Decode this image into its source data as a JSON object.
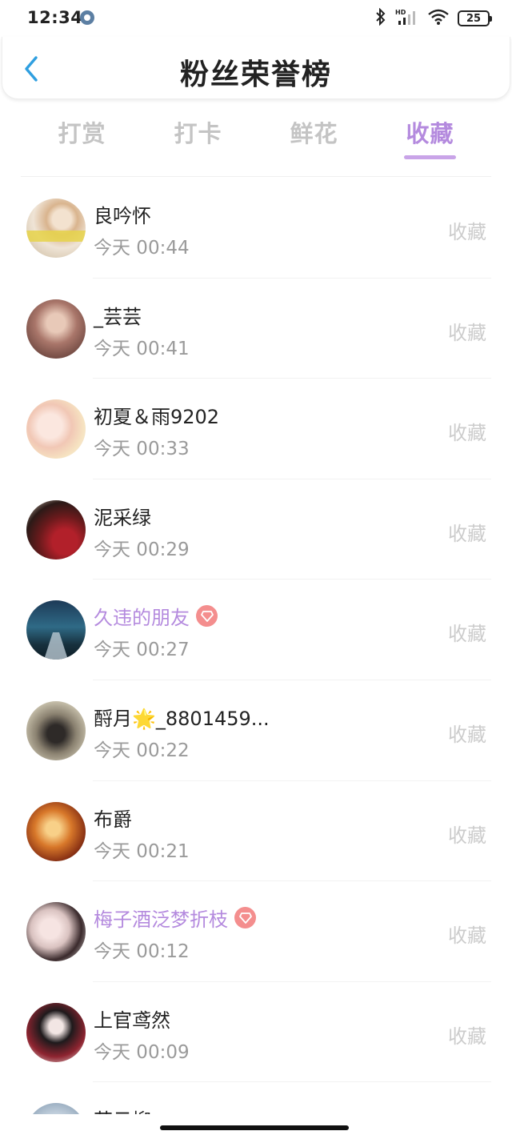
{
  "status_bar": {
    "time": "12:34",
    "battery": "25"
  },
  "header": {
    "title": "粉丝荣誉榜"
  },
  "tabs": [
    {
      "label": "打赏",
      "active": false
    },
    {
      "label": "打卡",
      "active": false
    },
    {
      "label": "鲜花",
      "active": false
    },
    {
      "label": "收藏",
      "active": true
    }
  ],
  "fans": [
    {
      "name": "良吟怀",
      "time": "今天 00:44",
      "action": "收藏",
      "vip": false
    },
    {
      "name": "_芸芸",
      "time": "今天 00:41",
      "action": "收藏",
      "vip": false
    },
    {
      "name": "初夏＆雨9202",
      "time": "今天 00:33",
      "action": "收藏",
      "vip": false
    },
    {
      "name": "泥采绿",
      "time": "今天 00:29",
      "action": "收藏",
      "vip": false
    },
    {
      "name": "久违的朋友",
      "time": "今天 00:27",
      "action": "收藏",
      "vip": true
    },
    {
      "name": "酹月🌟_8801459...",
      "time": "今天 00:22",
      "action": "收藏",
      "vip": false
    },
    {
      "name": "布爵",
      "time": "今天 00:21",
      "action": "收藏",
      "vip": false
    },
    {
      "name": "梅子酒泛梦折枝",
      "time": "今天 00:12",
      "action": "收藏",
      "vip": true
    },
    {
      "name": "上官鸢然",
      "time": "今天 00:09",
      "action": "收藏",
      "vip": false
    },
    {
      "name": "苏云柳",
      "time": "",
      "action": "",
      "vip": false
    }
  ],
  "colors": {
    "accent": "#b48ade",
    "tab_inactive": "#c4c4c4",
    "vip_badge": "#f48e8e",
    "back_arrow": "#2f9fe0"
  }
}
